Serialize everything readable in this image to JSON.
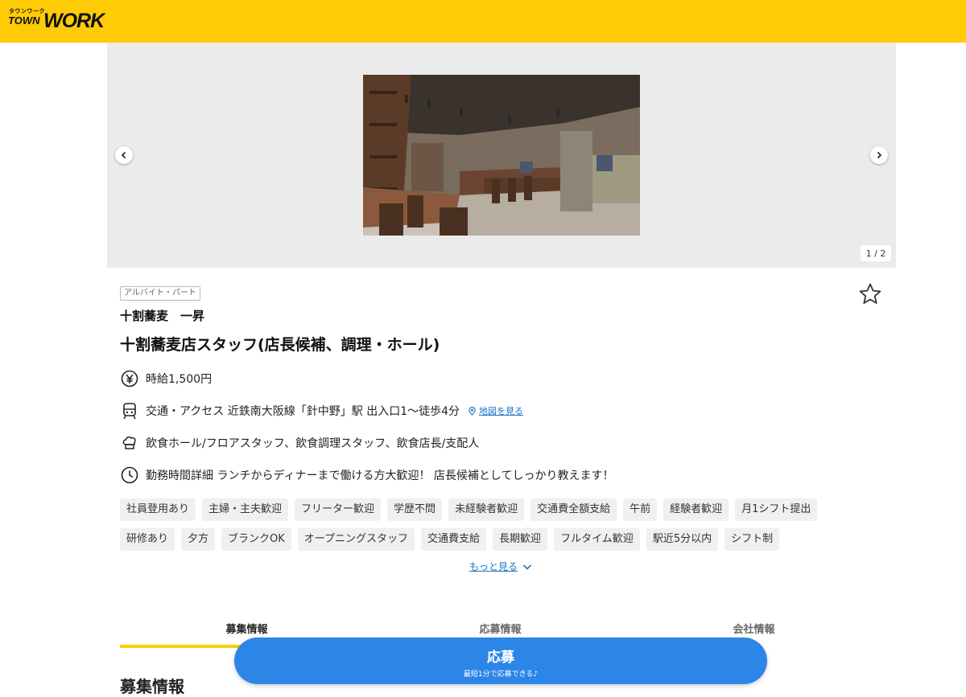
{
  "header": {
    "logo_small": "タウンワーク",
    "logo_town": "TOWN",
    "logo_work": "WORK"
  },
  "gallery": {
    "counter": "1 / 2",
    "current": 1,
    "total": 2
  },
  "job": {
    "employment_type": "アルバイト・パート",
    "company": "十割蕎麦　一昇",
    "title": "十割蕎麦店スタッフ(店長候補、調理・ホール)"
  },
  "info": {
    "wage": "時給1,500円",
    "access": "交通・アクセス 近鉄南大阪線「針中野」駅 出入口1～徒歩4分",
    "map_link": "地図を見る",
    "occupation": "飲食ホール/フロアスタッフ、飲食調理スタッフ、飲食店長/支配人",
    "hours": "勤務時間詳細 ランチからディナーまで働ける方大歓迎！ 店長候補としてしっかり教えます！"
  },
  "chips_row1": [
    "社員登用あり",
    "主婦・主夫歓迎",
    "フリーター歓迎",
    "学歴不問",
    "未経験者歓迎",
    "交通費全額支給",
    "午前",
    "経験者歓迎",
    "月1シフト提出"
  ],
  "chips_row2": [
    "研修あり",
    "夕方",
    "ブランクOK",
    "オープニングスタッフ",
    "交通費支給",
    "長期歓迎",
    "フルタイム歓迎",
    "駅近5分以内",
    "シフト制"
  ],
  "more_label": "もっと見る",
  "tabs": [
    {
      "label": "募集情報",
      "active": true
    },
    {
      "label": "応募情報",
      "active": false
    },
    {
      "label": "会社情報",
      "active": false
    }
  ],
  "section_heading": "募集情報",
  "apply": {
    "label": "応募",
    "sub": "最短1分で応募できる♪"
  },
  "colors": {
    "brand_yellow": "#FFCB05",
    "apply_blue": "#2B86E8",
    "link_blue": "#1a73c8"
  }
}
